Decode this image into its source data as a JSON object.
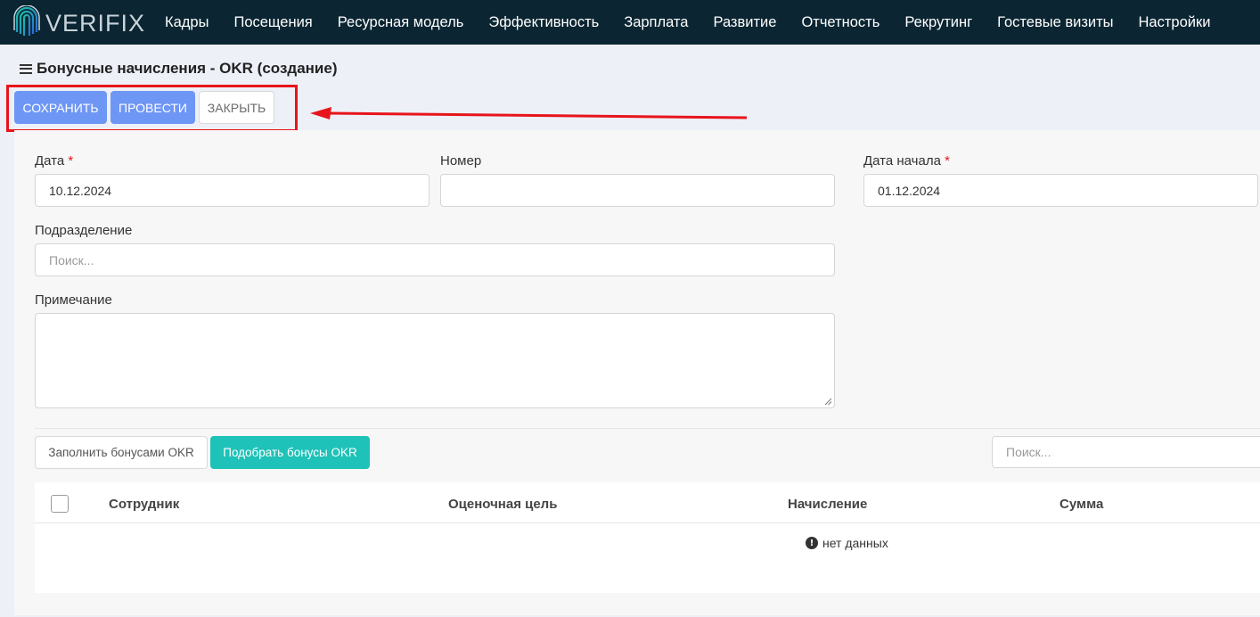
{
  "app": {
    "logo_text": "VERIFIX"
  },
  "nav": {
    "items": [
      "Кадры",
      "Посещения",
      "Ресурсная модель",
      "Эффективность",
      "Зарплата",
      "Развитие",
      "Отчетность",
      "Рекрутинг",
      "Гостевые визиты",
      "Настройки"
    ]
  },
  "page": {
    "title": "Бонусные начисления - OKR (создание)"
  },
  "toolbar": {
    "save_label": "СОХРАНИТЬ",
    "post_label": "ПРОВЕСТИ",
    "close_label": "ЗАКРЫТЬ"
  },
  "form": {
    "date": {
      "label": "Дата",
      "required_mark": "*",
      "value": "10.12.2024"
    },
    "number": {
      "label": "Номер",
      "value": ""
    },
    "start_date": {
      "label": "Дата начала",
      "required_mark": "*",
      "value": "01.12.2024"
    },
    "division": {
      "label": "Подразделение",
      "placeholder": "Поиск..."
    },
    "note": {
      "label": "Примечание",
      "value": ""
    }
  },
  "actions": {
    "fill_label": "Заполнить бонусами OKR",
    "pick_label": "Подобрать бонусы OKR",
    "search_placeholder": "Поиск..."
  },
  "table": {
    "columns": [
      "Сотрудник",
      "Оценочная цель",
      "Начисление",
      "Сумма"
    ],
    "empty_text": "нет данных"
  },
  "colors": {
    "topbar": "#0b2532",
    "primary": "#6e96f5",
    "teal": "#1fc2b8",
    "annotation": "#e8141b"
  }
}
